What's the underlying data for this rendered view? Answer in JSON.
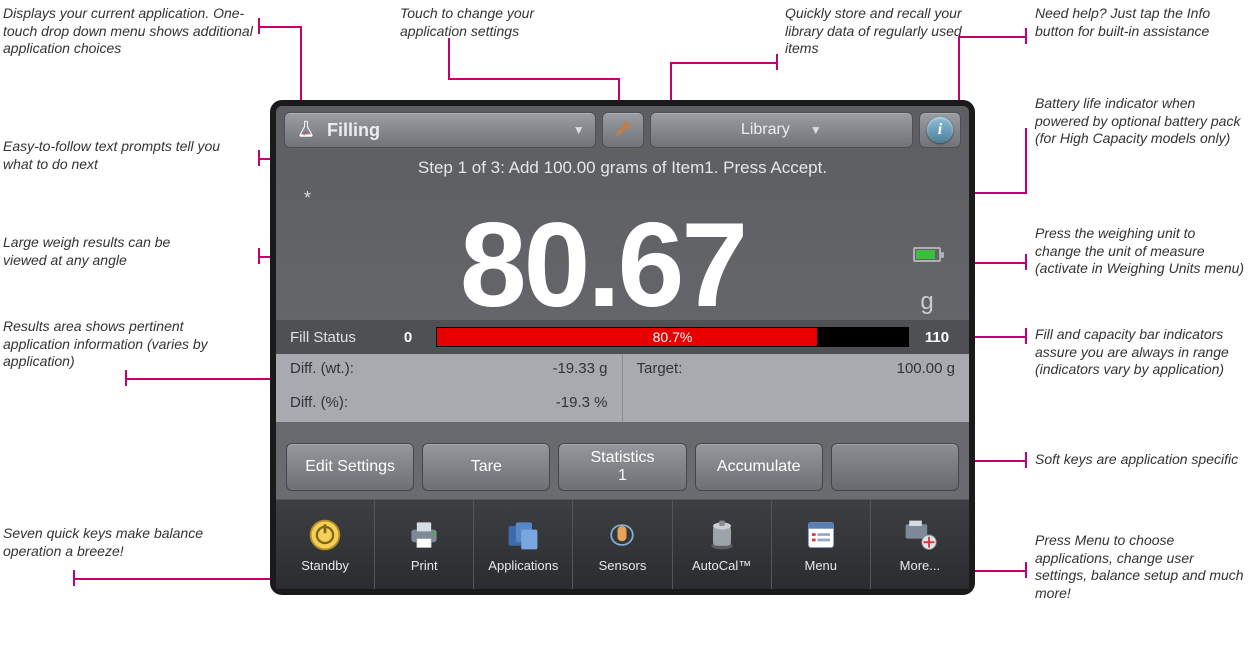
{
  "callouts": {
    "app_dropdown": "Displays your current application. One-touch drop down menu shows additional application choices",
    "settings": "Touch to change your application settings",
    "library": "Quickly store and recall your library data of regularly used items",
    "info": "Need help? Just tap the Info button for built-in assistance",
    "prompt": "Easy-to-follow text prompts tell you what to do next",
    "battery": "Battery life indicator when powered by optional battery pack (for High Capacity models only)",
    "weight": "Large weigh results can be viewed at any angle",
    "unit": "Press the weighing unit to change the unit of measure (activate in Weighing Units menu)",
    "results": "Results area shows pertinent application information (varies by application)",
    "fillbar": "Fill and capacity bar indicators assure you are always in range (indicators vary by application)",
    "softkeys": "Soft keys are application specific",
    "quickkeys": "Seven quick keys make balance operation a breeze!",
    "menu": "Press Menu to choose applications, change user settings, balance setup and much more!"
  },
  "topbar": {
    "app_name": "Filling",
    "library_label": "Library",
    "info_symbol": "i"
  },
  "prompt_text": "Step 1 of 3: Add 100.00 grams of Item1.  Press Accept.",
  "asterisk": "*",
  "weight_value": "80.67",
  "unit_label": "g",
  "fill": {
    "label": "Fill Status",
    "min": "0",
    "pct": "80.7%",
    "max": "110"
  },
  "results": {
    "diff_wt_label": "Diff. (wt.):",
    "diff_wt_value": "-19.33 g",
    "target_label": "Target:",
    "target_value": "100.00 g",
    "diff_pct_label": "Diff. (%):",
    "diff_pct_value": "-19.3 %"
  },
  "softkeys": {
    "edit": "Edit Settings",
    "tare": "Tare",
    "stats": "Statistics\n1",
    "accum": "Accumulate"
  },
  "quickkeys": {
    "standby": "Standby",
    "print": "Print",
    "apps": "Applications",
    "sensors": "Sensors",
    "autocal": "AutoCal™",
    "menu": "Menu",
    "more": "More..."
  }
}
